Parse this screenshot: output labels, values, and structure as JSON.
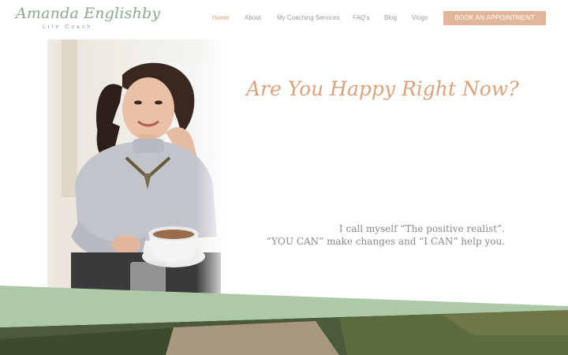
{
  "logo": {
    "name": "Amanda Englishby",
    "subtitle": "Life Coach"
  },
  "nav": {
    "items": [
      {
        "label": "Home",
        "active": true
      },
      {
        "label": "About"
      },
      {
        "label": "My Coaching Services"
      },
      {
        "label": "FAQ's"
      },
      {
        "label": "Blog"
      },
      {
        "label": "Vlogs"
      }
    ],
    "cta": "BOOK AN APPOINTMENT"
  },
  "hero": {
    "headline": "Are You Happy Right Now?",
    "quote_line1": "I call myself  “The positive realist”.",
    "quote_line2": "“YOU CAN” make changes and “I CAN” help you."
  },
  "colors": {
    "accent": "#d9a27b",
    "cta_bg": "#e2b799",
    "logo": "#8aa98a",
    "band": "#adc9a8",
    "nav_text": "#9a9a9a"
  },
  "icons": {
    "hero_image": "woman-with-coffee-photo",
    "footer_image": "garden-path-photo"
  }
}
